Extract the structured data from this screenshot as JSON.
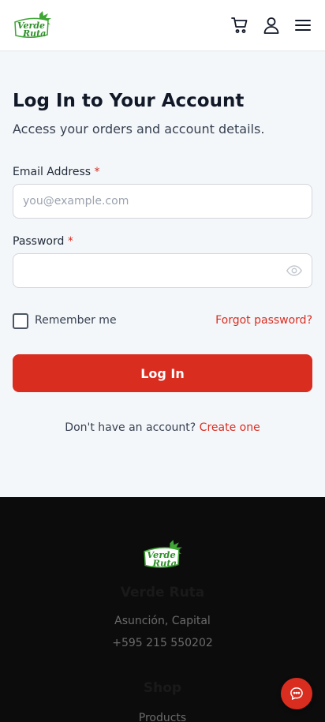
{
  "brand": {
    "logo_text_line1": "Verde",
    "logo_text_line2": "Ruta",
    "accent_color": "#d92d20",
    "logo_green": "#3fa535"
  },
  "header": {
    "icons": [
      "cart-icon",
      "user-icon",
      "menu-icon"
    ]
  },
  "login": {
    "title": "Log In to Your Account",
    "subtitle": "Access your orders and account details.",
    "email_label": "Email Address",
    "email_placeholder": "you@example.com",
    "email_value": "",
    "password_label": "Password",
    "password_value": "",
    "required_mark": "*",
    "remember_label": "Remember me",
    "remember_checked": false,
    "forgot_label": "Forgot password?",
    "submit_label": "Log In",
    "signup_prompt": "Don't have an account?",
    "signup_link": "Create one"
  },
  "footer": {
    "brand_name": "Verde Ruta",
    "location": "Asunción, Capital",
    "phone": "+595 215 550202",
    "shop_heading": "Shop",
    "shop_links": [
      "Products"
    ]
  },
  "chat": {
    "icon": "chat-icon"
  }
}
